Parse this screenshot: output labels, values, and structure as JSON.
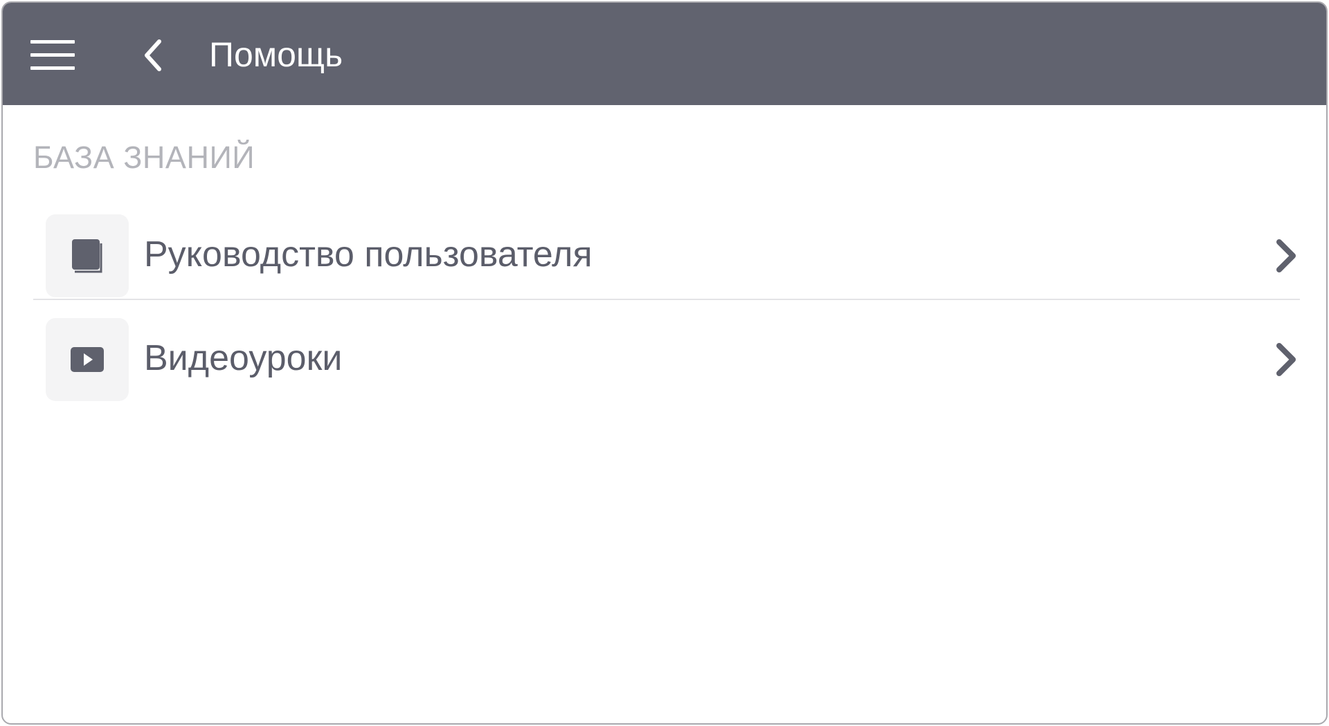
{
  "header": {
    "title": "Помощь",
    "menu_icon": "hamburger-menu-icon",
    "back_icon": "chevron-left-icon"
  },
  "knowledge_base": {
    "section_title": "БАЗА ЗНАНИЙ",
    "items": [
      {
        "label": "Руководство пользователя",
        "icon": "book-icon"
      },
      {
        "label": "Видеоуроки",
        "icon": "video-play-icon"
      }
    ]
  },
  "colors": {
    "header_bg": "#61636f",
    "header_text": "#ffffff",
    "section_title": "#b3b4ba",
    "item_text": "#5b5d6a",
    "icon_box_bg": "#f4f4f5",
    "divider": "#e3e3e6"
  }
}
